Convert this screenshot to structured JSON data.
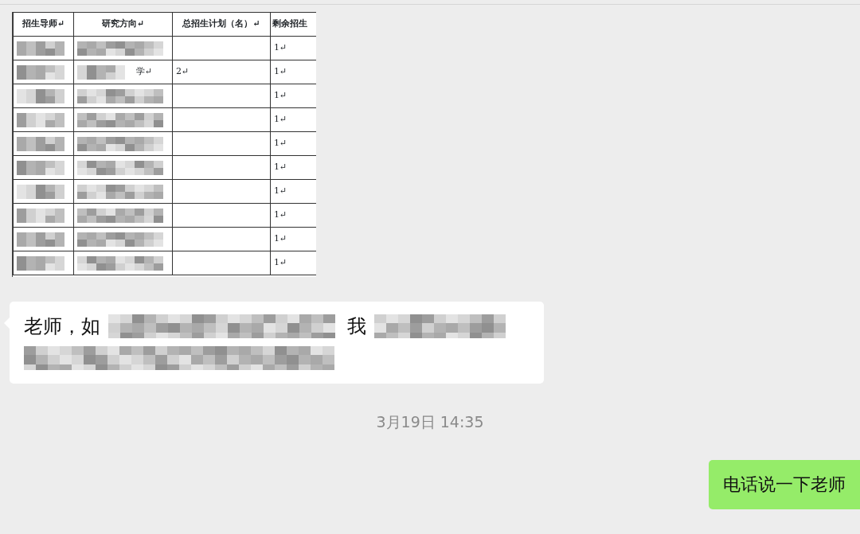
{
  "messages": [
    {
      "kind": "image",
      "table": {
        "columns": [
          "招生导师↵",
          "研究方向↵",
          "总招生计划（名）↵",
          "剩余招生"
        ],
        "rows": [
          {
            "redacted": true,
            "cells": [
              "",
              "",
              "",
              "1↵"
            ]
          },
          {
            "redacted": true,
            "cells": [
              "",
              "学↵",
              "2↵",
              "1↵"
            ]
          },
          {
            "redacted": true,
            "cells": [
              "",
              "",
              "",
              "1↵"
            ]
          },
          {
            "redacted": true,
            "cells": [
              "",
              "",
              "",
              "1↵"
            ]
          },
          {
            "redacted": true,
            "cells": [
              "",
              "",
              "",
              "1↵"
            ]
          },
          {
            "redacted": true,
            "cells": [
              "",
              "",
              "",
              "1↵"
            ]
          },
          {
            "redacted": true,
            "cells": [
              "",
              "",
              "",
              "1↵"
            ]
          },
          {
            "redacted": true,
            "cells": [
              "",
              "",
              "",
              "1↵"
            ]
          },
          {
            "redacted": true,
            "cells": [
              "",
              "",
              "",
              "1↵"
            ]
          },
          {
            "redacted": true,
            "cells": [
              "",
              "",
              "",
              "1↵"
            ]
          }
        ]
      }
    },
    {
      "kind": "text",
      "outgoing": false,
      "lines": [
        [
          {
            "kind": "text",
            "text": "老师，如"
          },
          {
            "kind": "redacted"
          },
          {
            "kind": "text",
            "text": "我"
          },
          {
            "kind": "redacted"
          }
        ],
        [
          {
            "kind": "redacted"
          }
        ]
      ]
    },
    {
      "kind": "time",
      "text": "3月19日 14:35"
    },
    {
      "kind": "text",
      "outgoing": true,
      "lines": [
        [
          {
            "kind": "text",
            "text": "电话说一下老师"
          }
        ]
      ]
    }
  ]
}
